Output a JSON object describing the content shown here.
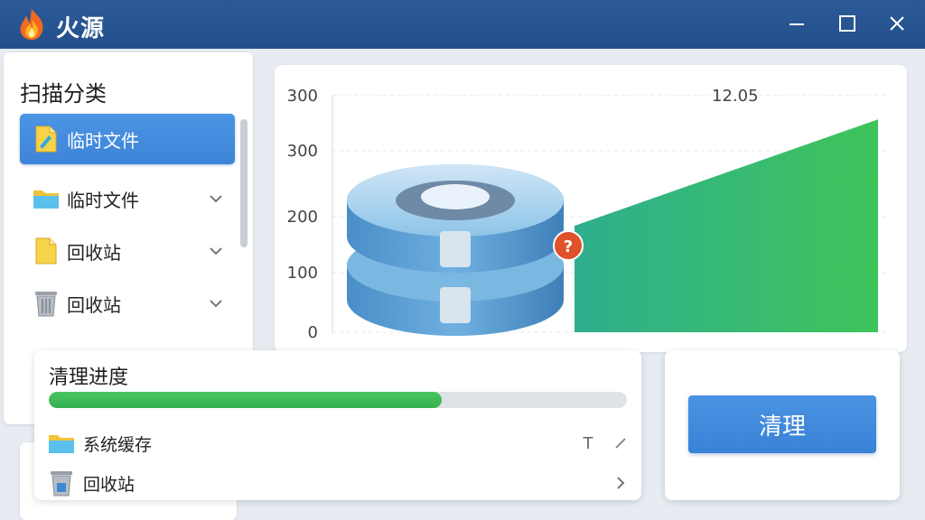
{
  "window": {
    "title": "火源",
    "controls": [
      "minimize-icon",
      "maximize-icon",
      "close-icon"
    ]
  },
  "sidebar": {
    "title": "扫描分类",
    "items": [
      {
        "label": "临时文件",
        "icon": "document-icon",
        "active": true
      },
      {
        "label": "临时文件",
        "icon": "folder-icon",
        "active": false
      },
      {
        "label": "回收站",
        "icon": "folder-icon",
        "active": false
      },
      {
        "label": "回收站",
        "icon": "trash-icon",
        "active": false
      }
    ]
  },
  "chart_data": {
    "type": "area",
    "y_ticks": [
      "0",
      "100",
      "200",
      "300",
      "300"
    ],
    "annotation": "12.05",
    "series": [
      {
        "x": [
          0,
          1
        ],
        "y": [
          180,
          360
        ]
      }
    ],
    "color": "#3ec45a",
    "grid": true
  },
  "progress": {
    "title": "清理进度",
    "value_fraction": 0.68,
    "files": [
      {
        "label": "系统缓存",
        "icon": "folder-icon",
        "actions": [
          "T",
          "edit-icon"
        ]
      },
      {
        "label": "回收站",
        "icon": "trash-icon",
        "actions": [
          "chevron-right-icon"
        ]
      }
    ]
  },
  "actions": {
    "clean_label": "清理"
  },
  "colors": {
    "titlebar": "#23508c",
    "accent": "#3d84d8",
    "progress": "#3ec45a",
    "warning": "#e0522a"
  }
}
